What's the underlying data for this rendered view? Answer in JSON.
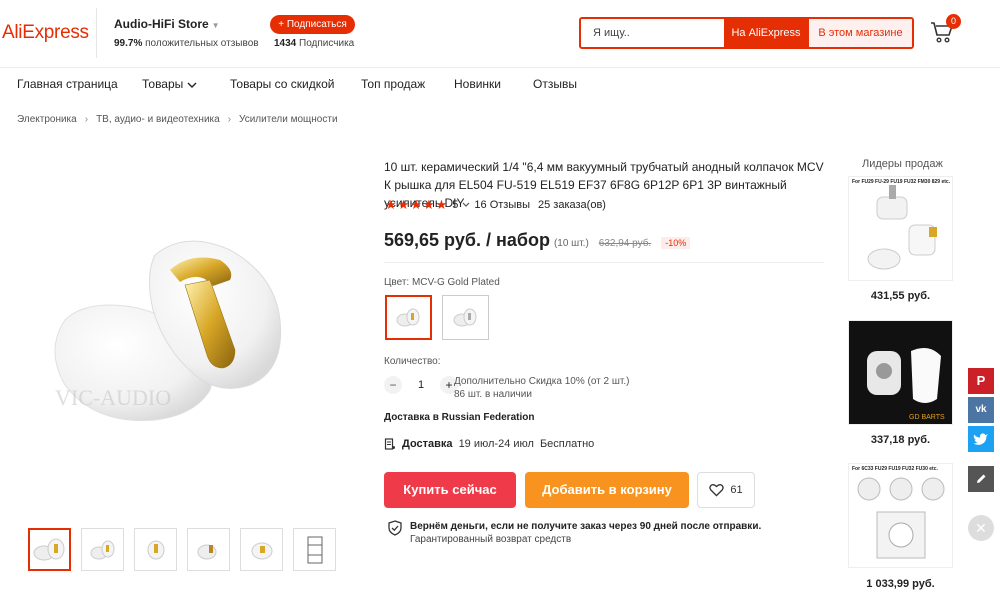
{
  "header": {
    "logo": "AliExpress",
    "store_name": "Audio-HiFi Store",
    "store_rating_value": "99.7%",
    "store_rating_text": "положительных отзывов",
    "subscribe_label": "+ Подписаться",
    "subscribers_count": "1434",
    "subscribers_text": "Подписчика",
    "search_placeholder": "Я ищу..",
    "search_aliexpress": "На AliExpress",
    "search_store": "В этом магазине",
    "cart_count": "0"
  },
  "nav": {
    "items": [
      "Главная страница",
      "Товары",
      "Товары со скидкой",
      "Топ продаж",
      "Новинки",
      "Отзывы"
    ]
  },
  "breadcrumb": [
    "Электроника",
    "ТВ, аудио- и видеотехника",
    "Усилители мощности"
  ],
  "product": {
    "title": "10 шт. керамический 1/4 \"6,4 мм вакуумный трубчатый анодный колпачок MCV К рышка для EL504 FU-519 EL519 EF37 6F8G 6P12P 6P1 3P винтажный усилитель DIY",
    "rating": "5",
    "reviews": "16 Отзывы",
    "orders": "25 заказа(ов)",
    "price": "569,65 руб. / набор",
    "unit": "(10 шт.)",
    "old_price": "632,94 руб.",
    "discount": "-10%",
    "watermark": "VIC-AUDIO",
    "color_label": "Цвет:",
    "color_value": "MCV-G Gold Plated",
    "qty_label": "Количество:",
    "qty_value": "1",
    "qty_minus": "−",
    "qty_plus": "+",
    "qty_discount": "Дополнительно Скидка 10% (от 2 шт.)",
    "qty_stock": "86 шт. в наличии",
    "ship_to": "Доставка в Russian Federation",
    "delivery_label": "Доставка",
    "delivery_dates": "19 июл-24 июл",
    "delivery_price": "Бесплатно",
    "buy_label": "Купить сейчас",
    "cart_label": "Добавить в корзину",
    "wishlist_count": "61",
    "guarantee_title": "Вернём деньги, если не получите заказ через 90 дней после отправки.",
    "guarantee_sub": "Гарантированный возврат средств"
  },
  "sidebar": {
    "title": "Лидеры продаж",
    "items": [
      {
        "caption": "For FU29 FU-29 FU19 FU32 FM30 829 etc.",
        "price": "431,55 руб."
      },
      {
        "caption": "GD BARTS",
        "price": "337,18 руб."
      },
      {
        "caption": "For 6C33 FU29 FU19 FU32 FU30 etc.",
        "price": "1 033,99 руб."
      }
    ]
  },
  "social": [
    "pinterest-icon",
    "vk-icon",
    "twitter-icon",
    "edit-icon"
  ],
  "colors": {
    "accent": "#e62e04",
    "buy": "#ef3b49",
    "cart": "#f7931e"
  }
}
